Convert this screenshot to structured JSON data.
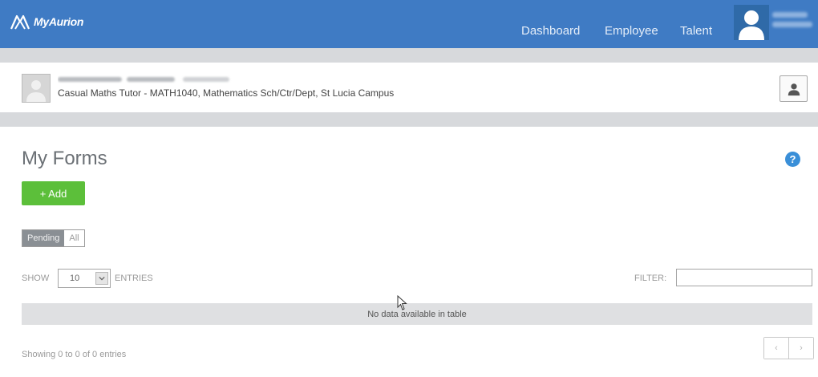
{
  "header": {
    "brand": "MyAurion",
    "nav": [
      {
        "label": "Dashboard"
      },
      {
        "label": "Employee"
      },
      {
        "label": "Talent"
      }
    ],
    "avatar_icon": "user-silhouette-icon",
    "colors": {
      "bar": "#3f7bc4"
    }
  },
  "person": {
    "role": "Casual Maths Tutor - MATH1040, Mathematics Sch/Ctr/Dept, St Lucia Campus",
    "profile_icon": "person-icon"
  },
  "main": {
    "title": "My Forms",
    "help_symbol": "?",
    "add_label": "+ Add",
    "tabs": [
      {
        "label": "Pending",
        "active": true
      },
      {
        "label": "All",
        "active": false
      }
    ],
    "show_label": "SHOW",
    "entries_value": "10",
    "entries_label": "ENTRIES",
    "filter_label": "FILTER:",
    "filter_value": "",
    "empty_message": "No data available in table",
    "showing_text": "Showing 0 to 0 of 0 entries",
    "pager": {
      "prev": "‹",
      "next": "›"
    },
    "colors": {
      "add": "#5cbf3a",
      "help": "#3a8fd8"
    }
  }
}
